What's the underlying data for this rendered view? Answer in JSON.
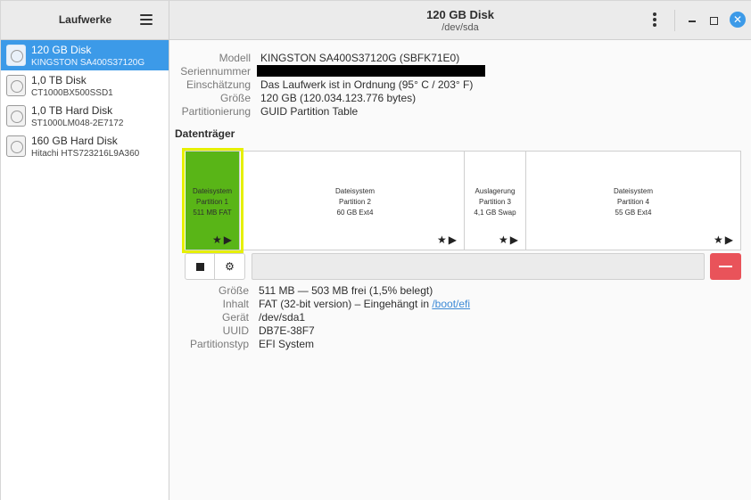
{
  "sidebar": {
    "title": "Laufwerke",
    "drives": [
      {
        "name": "120 GB Disk",
        "model": "KINGSTON SA400S37120G",
        "selected": true
      },
      {
        "name": "1,0 TB Disk",
        "model": "CT1000BX500SSD1",
        "selected": false
      },
      {
        "name": "1,0 TB Hard Disk",
        "model": "ST1000LM048-2E7172",
        "selected": false
      },
      {
        "name": "160 GB Hard Disk",
        "model": "Hitachi HTS723216L9A360",
        "selected": false
      }
    ]
  },
  "header": {
    "title": "120 GB Disk",
    "subtitle": "/dev/sda",
    "close_glyph": "✕"
  },
  "disk_info": {
    "labels": {
      "model": "Modell",
      "serial": "Seriennummer",
      "assessment": "Einschätzung",
      "size": "Größe",
      "partitioning": "Partitionierung"
    },
    "values": {
      "model": "KINGSTON SA400S37120G (SBFK71E0)",
      "serial": "",
      "assessment": "Das Laufwerk ist in Ordnung (95° C / 203° F)",
      "size": "120 GB (120.034.123.776 bytes)",
      "partitioning": "GUID Partition Table"
    }
  },
  "volumes": {
    "section_title": "Datenträger",
    "partitions": [
      {
        "line1": "Dateisystem",
        "line2": "Partition 1",
        "line3": "511 MB FAT",
        "selected": true
      },
      {
        "line1": "Dateisystem",
        "line2": "Partition 2",
        "line3": "60 GB Ext4",
        "selected": false
      },
      {
        "line1": "Auslagerung",
        "line2": "Partition 3",
        "line3": "4,1 GB Swap",
        "selected": false
      },
      {
        "line1": "Dateisystem",
        "line2": "Partition 4",
        "line3": "55 GB Ext4",
        "selected": false
      }
    ],
    "part_icons": "★▶",
    "gear_glyph": "⚙"
  },
  "partition_info": {
    "labels": {
      "size": "Größe",
      "content": "Inhalt",
      "device": "Gerät",
      "uuid": "UUID",
      "type": "Partitionstyp"
    },
    "values": {
      "size": "511 MB — 503 MB frei (1,5% belegt)",
      "content_prefix": "FAT (32-bit version) – Eingehängt in",
      "content_link": "/boot/efi",
      "device": "/dev/sda1",
      "uuid": "DB7E-38F7",
      "type": "EFI System"
    }
  },
  "colors": {
    "accent": "#3c9ae8",
    "selected_partition": "#59b517",
    "selection_highlight": "#e6f000",
    "delete": "#e9535a"
  }
}
